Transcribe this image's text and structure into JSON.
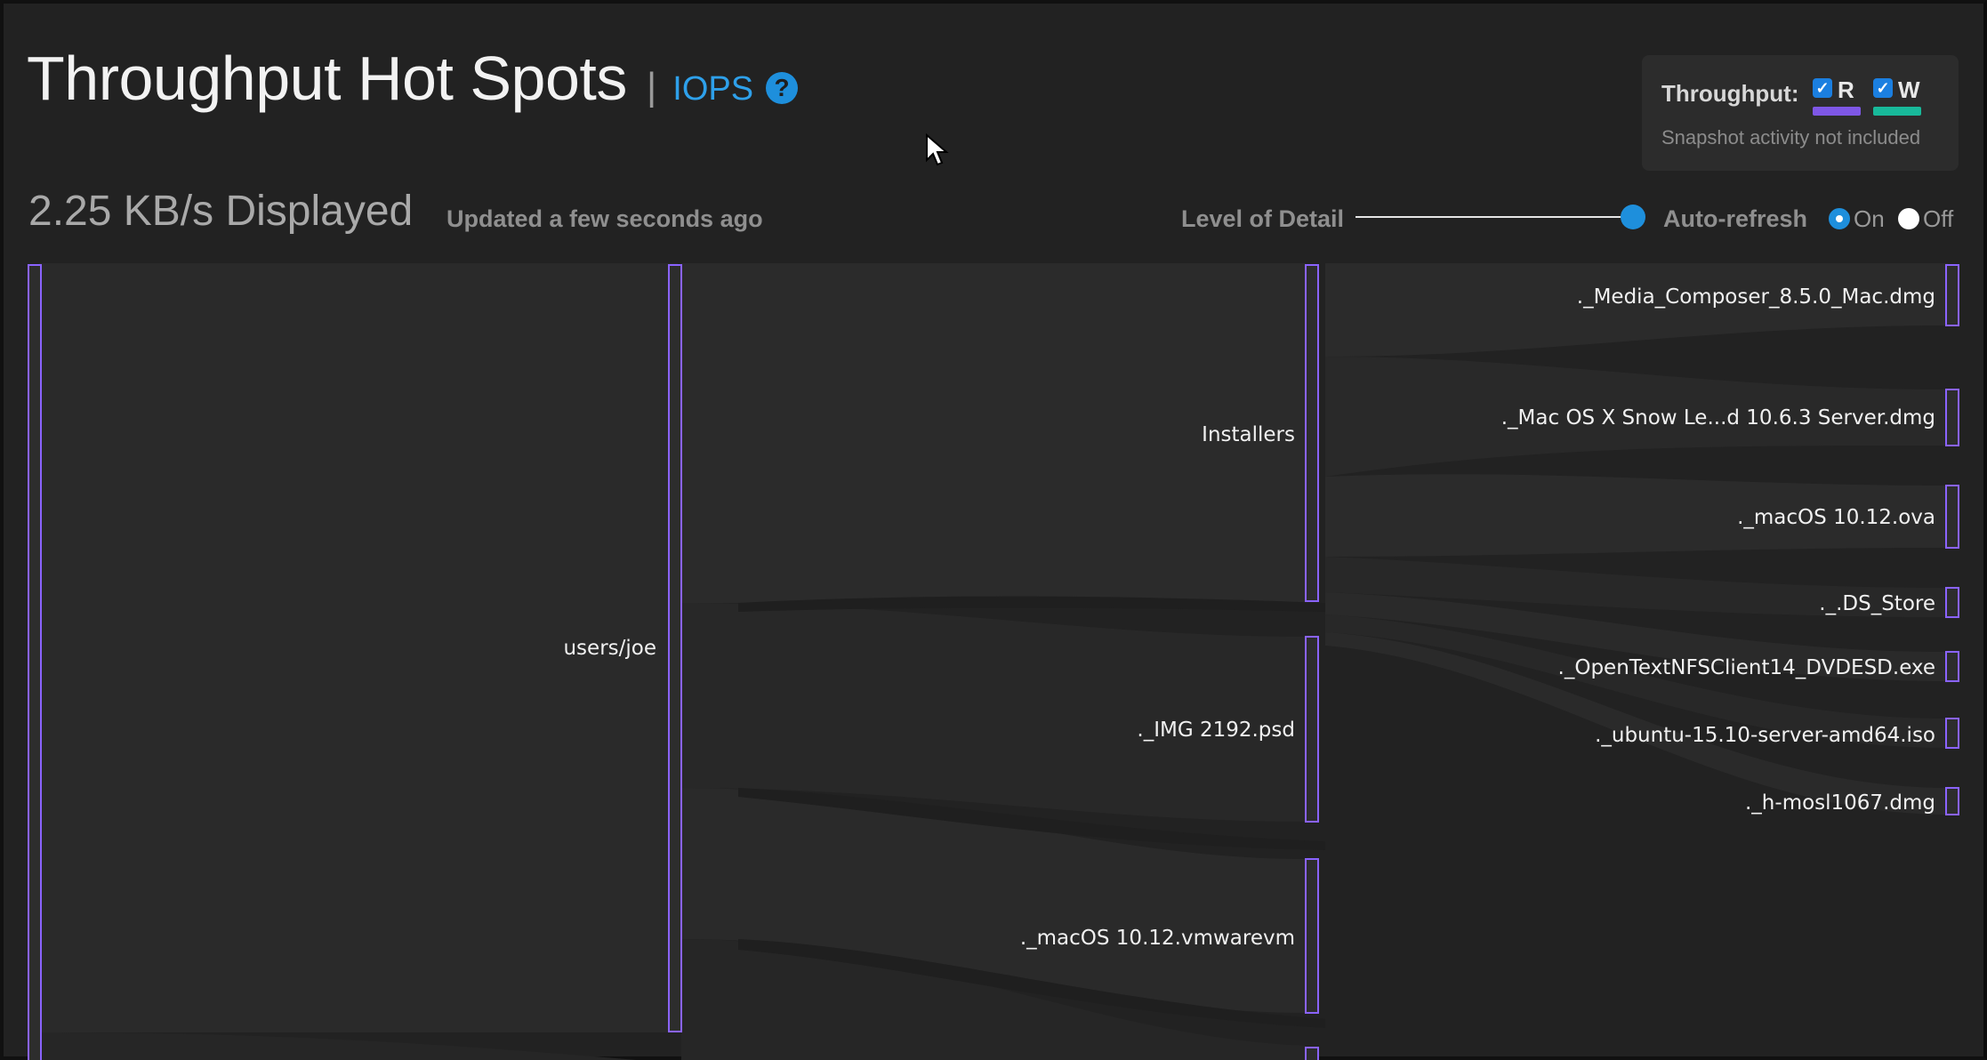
{
  "header": {
    "title": "Throughput Hot Spots",
    "separator": "|",
    "alt_link": "IOPS",
    "help_glyph": "?"
  },
  "legend": {
    "label": "Throughput:",
    "read_letter": "R",
    "write_letter": "W",
    "read_checked": true,
    "write_checked": true,
    "read_color": "#7e57e6",
    "write_color": "#18b99a",
    "note": "Snapshot activity not included"
  },
  "status": {
    "displayed": "2.25 KB/s Displayed",
    "updated": "Updated a few seconds ago",
    "level_of_detail_label": "Level of Detail",
    "level_of_detail_value": 1.0,
    "auto_refresh_label": "Auto-refresh",
    "on_label": "On",
    "off_label": "Off",
    "auto_refresh": "On"
  },
  "colors": {
    "background": "#222222",
    "node_fill": "#2c2c2c",
    "node_border": "#8a63ff",
    "accent": "#1e8fdc"
  },
  "sankey": {
    "columns": [
      {
        "nodes": [
          {
            "label": ""
          }
        ]
      },
      {
        "nodes": [
          {
            "label": "users/joe"
          }
        ]
      },
      {
        "nodes": [
          {
            "label": "Installers"
          },
          {
            "label": "._IMG 2192.psd"
          },
          {
            "label": "._macOS 10.12.vmwarevm"
          }
        ]
      },
      {
        "nodes": [
          {
            "label": "._Media_Composer_8.5.0_Mac.dmg"
          },
          {
            "label": "._Mac OS X Snow Le...d 10.6.3 Server.dmg"
          },
          {
            "label": "._macOS 10.12.ova"
          },
          {
            "label": "._.DS_Store"
          },
          {
            "label": "._OpenTextNFSClient14_DVDESD.exe"
          },
          {
            "label": "._ubuntu-15.10-server-amd64.iso"
          },
          {
            "label": "._h-mosl1067.dmg"
          }
        ]
      }
    ]
  }
}
